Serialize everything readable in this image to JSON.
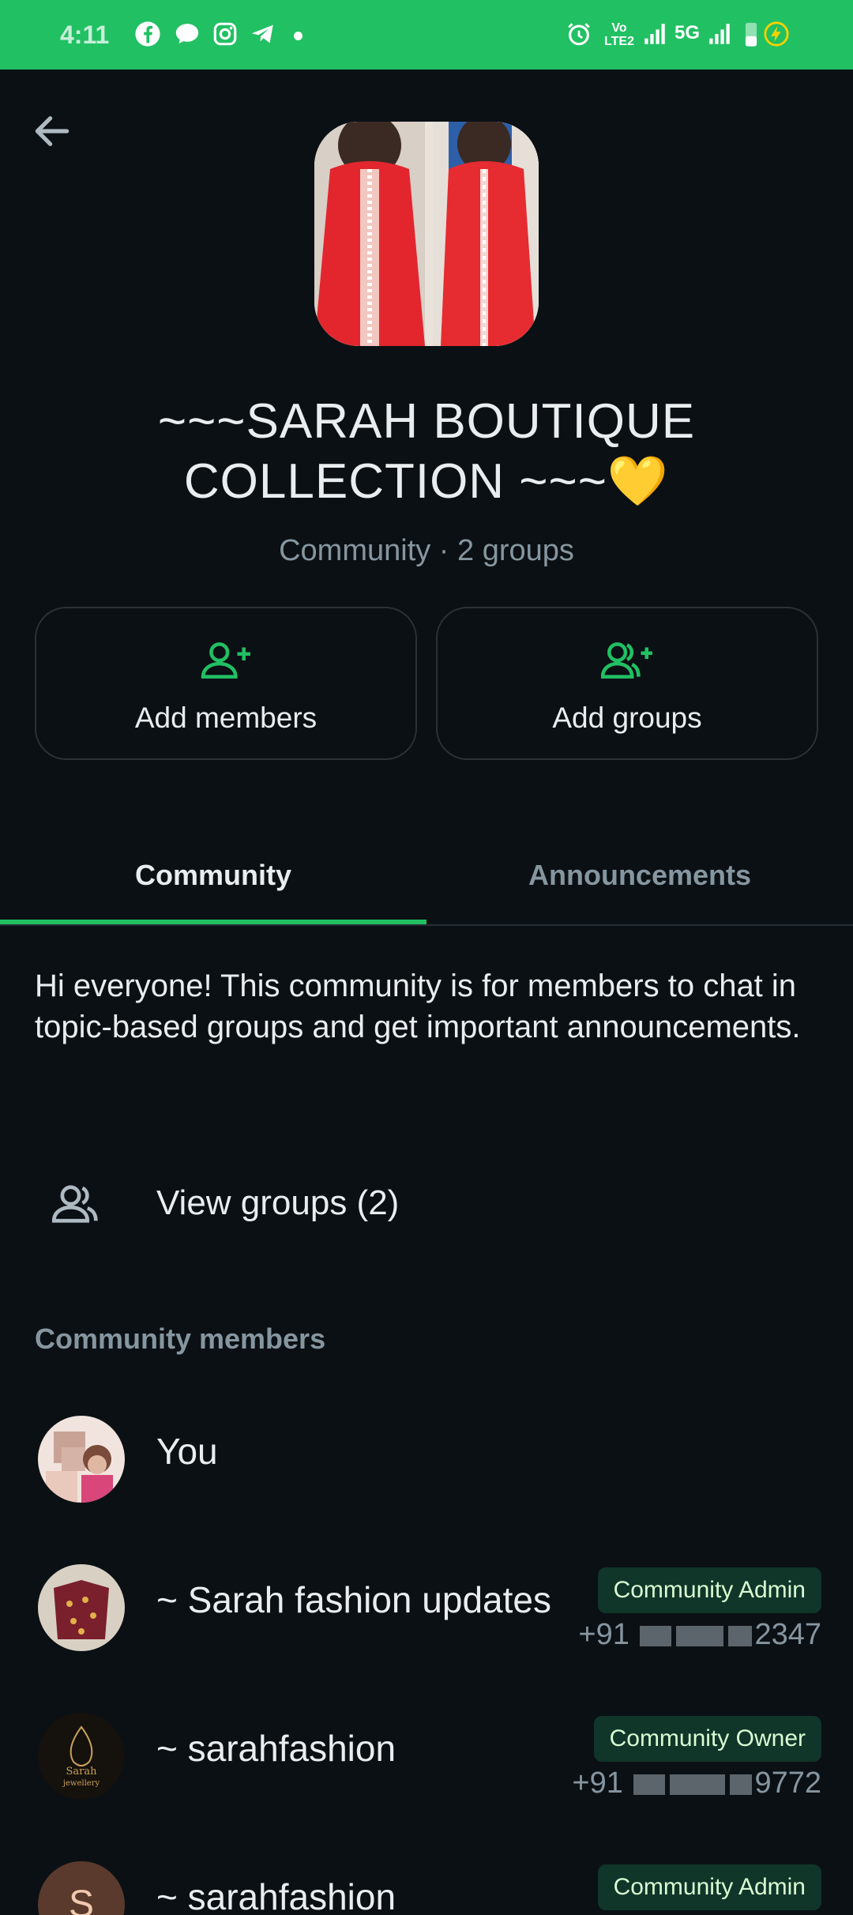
{
  "status_bar": {
    "time": "4:11",
    "network": "5G",
    "volte": "Vo LTE2",
    "icons": [
      "facebook-icon",
      "chat-bubble-icon",
      "instagram-icon",
      "telegram-icon",
      "alarm-icon",
      "signal-icon",
      "battery-charging-icon"
    ]
  },
  "community": {
    "title": "~~~SARAH BOUTIQUE COLLECTION ~~~💛",
    "subtitle": "Community · 2 groups"
  },
  "actions": {
    "add_members": "Add members",
    "add_groups": "Add groups"
  },
  "tabs": [
    {
      "label": "Community",
      "active": true
    },
    {
      "label": "Announcements",
      "active": false
    }
  ],
  "description": "Hi everyone! This community is for members to chat in topic-based groups and get important announcements.",
  "view_groups_label": "View groups (2)",
  "members_header": "Community members",
  "members": [
    {
      "name": "You",
      "badge": "",
      "phone": ""
    },
    {
      "name": "~ Sarah fashion updates",
      "badge": "Community Admin",
      "phone_prefix": "+91",
      "phone_suffix": "2347"
    },
    {
      "name": "~ sarahfashion",
      "badge": "Community Owner",
      "phone_prefix": "+91",
      "phone_suffix": "9772"
    },
    {
      "name": "~ sarahfashion",
      "badge": "Community Admin",
      "avatar_letter": "S"
    }
  ],
  "avatar_logo_text": [
    "Sarah",
    "jewellery"
  ],
  "colors": {
    "accent": "#21c063",
    "background": "#0b1014",
    "badge_bg": "#103529",
    "muted_text": "#8696a0"
  }
}
